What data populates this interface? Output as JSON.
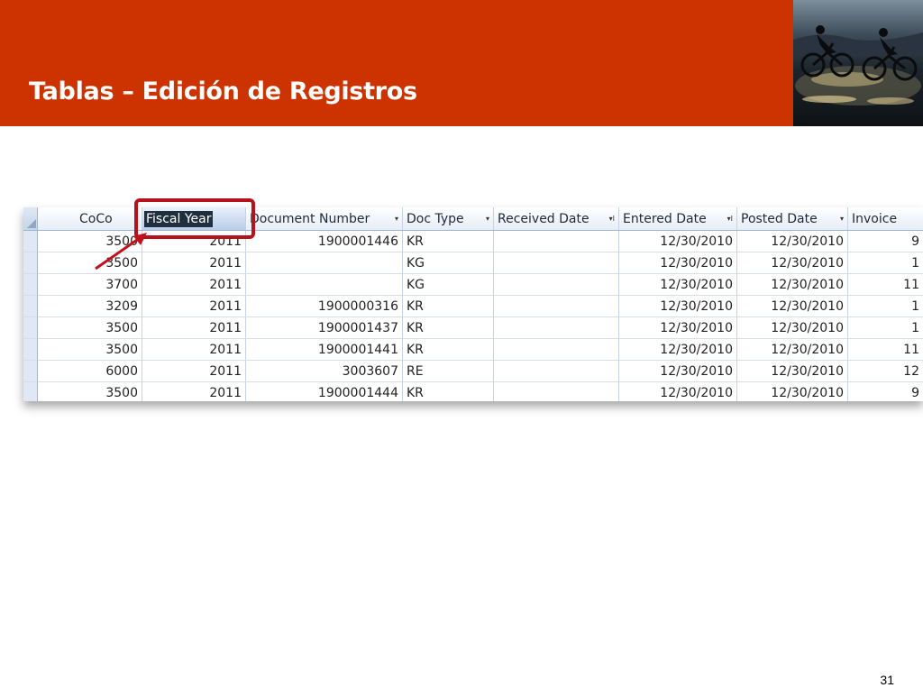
{
  "slide": {
    "title": "Tablas – Edición de Registros",
    "page_number": "31",
    "accent_color": "#cc3300",
    "highlight_color": "#b5121b",
    "header_image": "cyclists-photo"
  },
  "datasheet": {
    "columns": [
      {
        "label": "CoCo",
        "has_dropdown": true
      },
      {
        "label": "Fiscal Year",
        "selected": true
      },
      {
        "label": "Document Number",
        "has_dropdown": true
      },
      {
        "label": "Doc Type",
        "has_dropdown": true
      },
      {
        "label": "Received Date",
        "has_sort_filter": true
      },
      {
        "label": "Entered Date",
        "has_sort_filter": true
      },
      {
        "label": "Posted Date",
        "has_dropdown": true
      },
      {
        "label": "Invoice"
      }
    ],
    "rows": [
      [
        "3500",
        "2011",
        "1900001446",
        "KR",
        "",
        "12/30/2010",
        "12/30/2010",
        "9"
      ],
      [
        "3500",
        "2011",
        "",
        "KG",
        "",
        "12/30/2010",
        "12/30/2010",
        "1"
      ],
      [
        "3700",
        "2011",
        "",
        "KG",
        "",
        "12/30/2010",
        "12/30/2010",
        "11"
      ],
      [
        "3209",
        "2011",
        "1900000316",
        "KR",
        "",
        "12/30/2010",
        "12/30/2010",
        "1"
      ],
      [
        "3500",
        "2011",
        "1900001437",
        "KR",
        "",
        "12/30/2010",
        "12/30/2010",
        "1"
      ],
      [
        "3500",
        "2011",
        "1900001441",
        "KR",
        "",
        "12/30/2010",
        "12/30/2010",
        "11"
      ],
      [
        "6000",
        "2011",
        "3003607",
        "RE",
        "",
        "12/30/2010",
        "12/30/2010",
        "12"
      ],
      [
        "3500",
        "2011",
        "1900001444",
        "KR",
        "",
        "12/30/2010",
        "12/30/2010",
        "9"
      ]
    ],
    "dropdown_glyph": "▾",
    "sort_filter_glyph": "▾I"
  }
}
